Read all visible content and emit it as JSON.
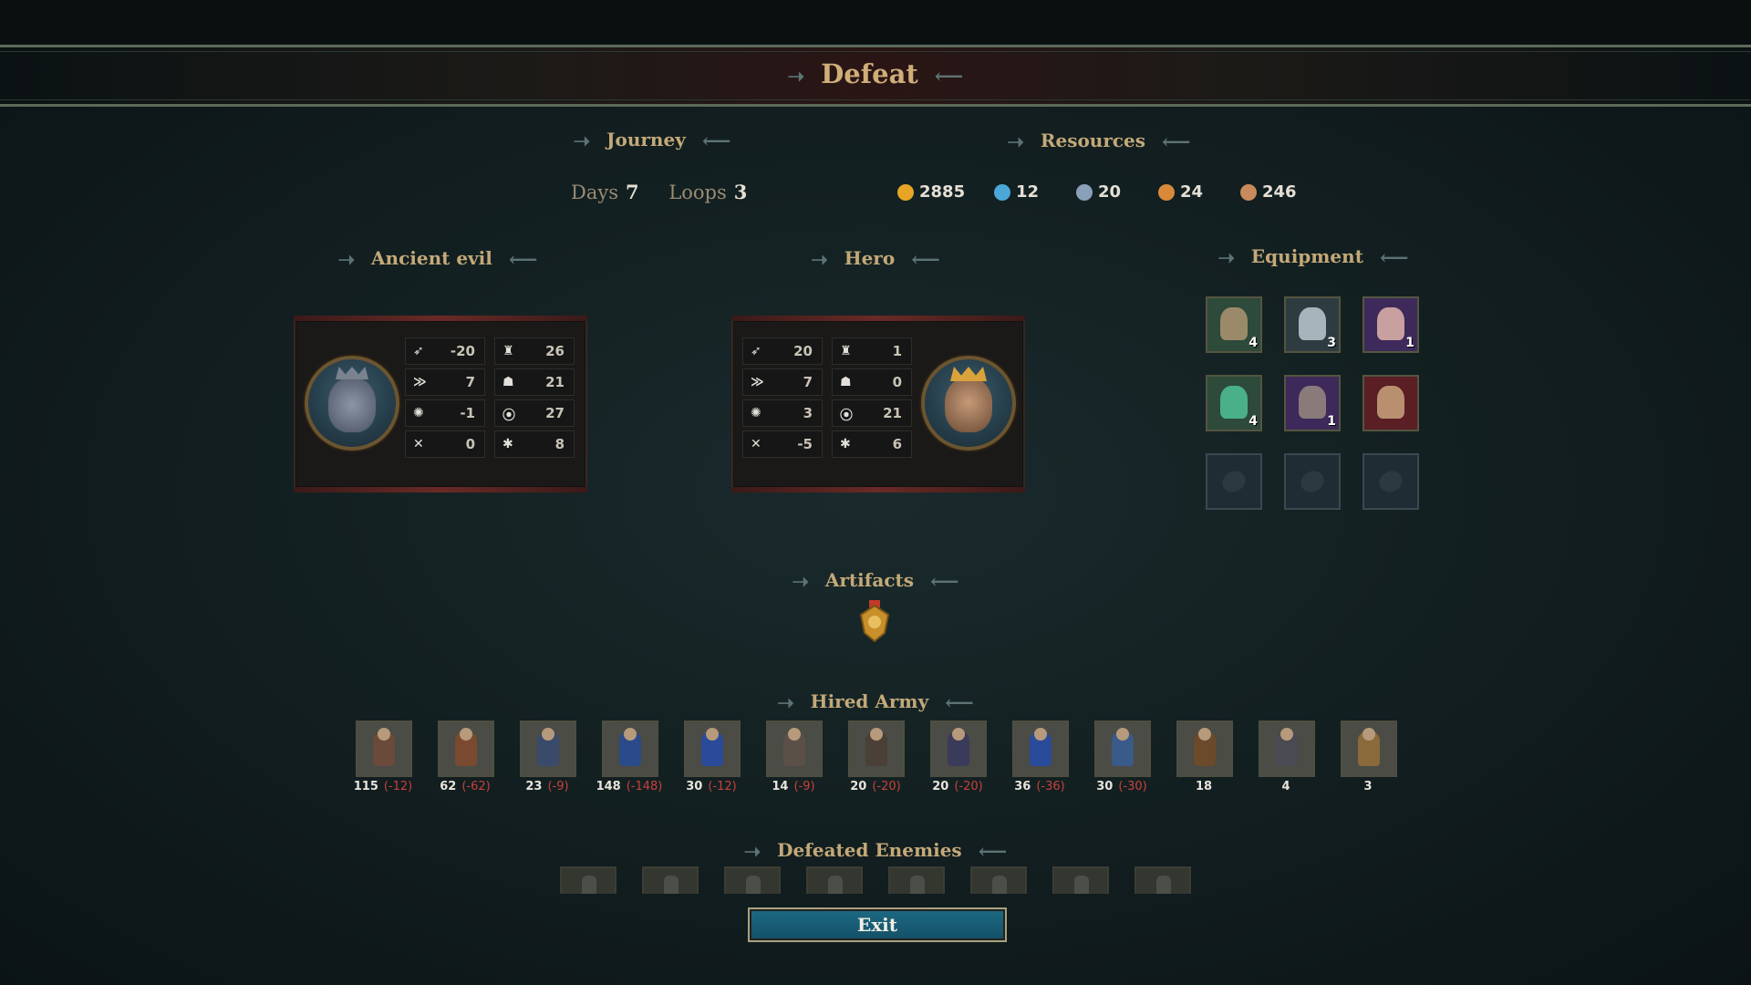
{
  "screen_title": "Defeat",
  "sections": {
    "journey": "Journey",
    "resources": "Resources",
    "ancient_evil": "Ancient evil",
    "hero": "Hero",
    "equipment": "Equipment",
    "artifacts": "Artifacts",
    "hired_army": "Hired Army",
    "defeated_enemies": "Defeated Enemies"
  },
  "journey": {
    "days_label": "Days",
    "days_value": "7",
    "loops_label": "Loops",
    "loops_value": "3"
  },
  "resources": [
    {
      "icon": "gold-coin-icon",
      "value": "2885",
      "color": "#e7a526"
    },
    {
      "icon": "crystal-icon",
      "value": "12",
      "color": "#4aa7d8"
    },
    {
      "icon": "ore-icon",
      "value": "20",
      "color": "#8aa0b8"
    },
    {
      "icon": "wood-icon",
      "value": "24",
      "color": "#d88a3a"
    },
    {
      "icon": "food-icon",
      "value": "246",
      "color": "#c88a5a"
    }
  ],
  "ancient_evil_stats": [
    {
      "icon": "attack-icon",
      "value": "-20"
    },
    {
      "icon": "speed-icon",
      "value": "7"
    },
    {
      "icon": "morale-icon",
      "value": "-1"
    },
    {
      "icon": "luck-icon",
      "value": "0"
    },
    {
      "icon": "defense-icon",
      "value": "26"
    },
    {
      "icon": "knowledge-icon",
      "value": "21"
    },
    {
      "icon": "spell-power-icon",
      "value": "27"
    },
    {
      "icon": "magic-icon",
      "value": "8"
    }
  ],
  "hero_stats": [
    {
      "icon": "attack-icon",
      "value": "20"
    },
    {
      "icon": "speed-icon",
      "value": "7"
    },
    {
      "icon": "morale-icon",
      "value": "3"
    },
    {
      "icon": "luck-icon",
      "value": "-5"
    },
    {
      "icon": "defense-icon",
      "value": "1"
    },
    {
      "icon": "knowledge-icon",
      "value": "0"
    },
    {
      "icon": "spell-power-icon",
      "value": "21"
    },
    {
      "icon": "magic-icon",
      "value": "6"
    }
  ],
  "equipment": [
    {
      "name": "helmet",
      "count": "4",
      "bg": "#2d4a3a",
      "color": "#9a8a6a"
    },
    {
      "name": "chest-armor",
      "count": "3",
      "bg": "#2e3c42",
      "color": "#a8b4bc"
    },
    {
      "name": "gauntlets",
      "count": "1",
      "bg": "#3d2a5a",
      "color": "#c8a0a0"
    },
    {
      "name": "staff",
      "count": "4",
      "bg": "#2d4a3a",
      "color": "#4ab08a"
    },
    {
      "name": "shield",
      "count": "1",
      "bg": "#3d2a5a",
      "color": "#8a7a7a"
    },
    {
      "name": "amulet",
      "count": "",
      "bg": "#5a1e24",
      "color": "#b89070"
    },
    {
      "name": "empty-slot",
      "count": "",
      "bg": "",
      "color": ""
    },
    {
      "name": "empty-slot",
      "count": "",
      "bg": "",
      "color": ""
    },
    {
      "name": "empty-slot",
      "count": "",
      "bg": "",
      "color": ""
    }
  ],
  "army": [
    {
      "count": "115",
      "loss": "(-12)",
      "color": "#6a4a3a"
    },
    {
      "count": "62",
      "loss": "(-62)",
      "color": "#7a4a30"
    },
    {
      "count": "23",
      "loss": "(-9)",
      "color": "#3a4a6a"
    },
    {
      "count": "148",
      "loss": "(-148)",
      "color": "#2a4a8a"
    },
    {
      "count": "30",
      "loss": "(-12)",
      "color": "#2a4a9a"
    },
    {
      "count": "14",
      "loss": "(-9)",
      "color": "#5a5048"
    },
    {
      "count": "20",
      "loss": "(-20)",
      "color": "#4a4038"
    },
    {
      "count": "20",
      "loss": "(-20)",
      "color": "#3a3a5a"
    },
    {
      "count": "36",
      "loss": "(-36)",
      "color": "#2a4a9a"
    },
    {
      "count": "30",
      "loss": "(-30)",
      "color": "#3a5a8a"
    },
    {
      "count": "18",
      "loss": "",
      "color": "#6a4a2a"
    },
    {
      "count": "4",
      "loss": "",
      "color": "#4a4a52"
    },
    {
      "count": "3",
      "loss": "",
      "color": "#8a6a3a"
    }
  ],
  "exit_label": "Exit"
}
